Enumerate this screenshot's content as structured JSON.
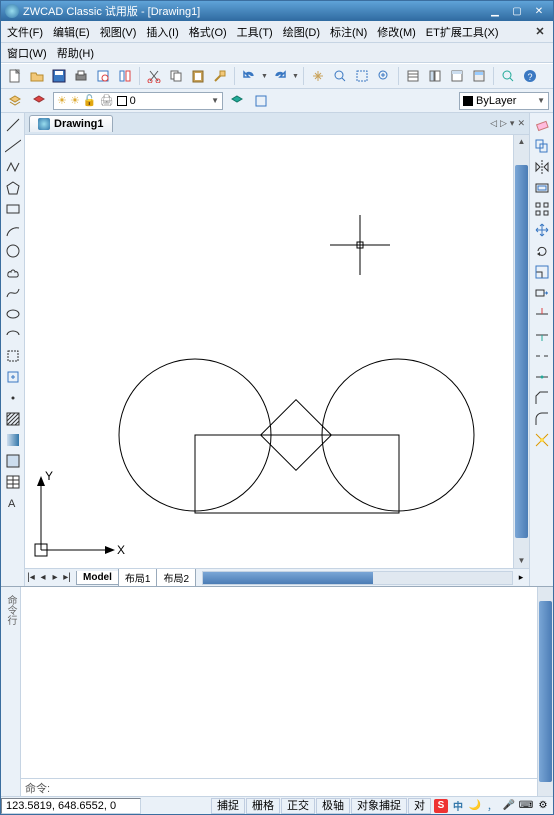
{
  "title": "ZWCAD Classic 试用版 - [Drawing1]",
  "menubar": [
    "文件(F)",
    "编辑(E)",
    "视图(V)",
    "插入(I)",
    "格式(O)",
    "工具(T)",
    "绘图(D)",
    "标注(N)",
    "修改(M)",
    "ET扩展工具(X)"
  ],
  "menubar2": [
    "窗口(W)",
    "帮助(H)"
  ],
  "doc_tab": "Drawing1",
  "layer_name": "0",
  "bylayer": "ByLayer",
  "layout_tabs": {
    "model": "Model",
    "l1": "布局1",
    "l2": "布局2"
  },
  "cmd": {
    "handle": "命令行",
    "prompt": "命令:"
  },
  "status": {
    "coords": "123.5819, 648.6552, 0",
    "buttons": [
      "捕捉",
      "栅格",
      "正交",
      "极轴",
      "对象捕捉",
      "对"
    ]
  },
  "tray": {
    "s_badge": "S",
    "cn": "中"
  },
  "ucs": {
    "x": "X",
    "y": "Y"
  },
  "tabnav": {
    "first": "◀",
    "close": "✕"
  }
}
